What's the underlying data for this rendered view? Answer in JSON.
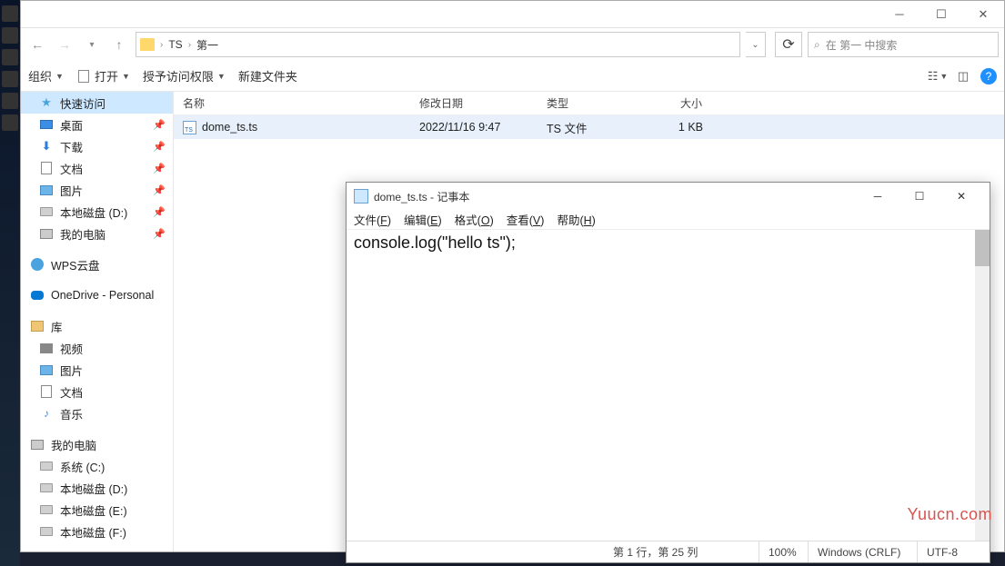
{
  "explorer": {
    "breadcrumb": {
      "seg1": "TS",
      "seg2": "第一"
    },
    "search_placeholder": "在 第一 中搜索",
    "toolbar": {
      "organize": "组织",
      "open": "打开",
      "grant": "授予访问权限",
      "new_folder": "新建文件夹"
    },
    "columns": {
      "name": "名称",
      "date": "修改日期",
      "type": "类型",
      "size": "大小"
    },
    "file": {
      "name": "dome_ts.ts",
      "date": "2022/11/16 9:47",
      "type": "TS 文件",
      "size": "1 KB"
    },
    "sidebar": {
      "quick": "快速访问",
      "desktop": "桌面",
      "downloads": "下载",
      "documents": "文档",
      "pictures": "图片",
      "disk_d": "本地磁盘 (D:)",
      "my_pc": "我的电脑",
      "wps": "WPS云盘",
      "onedrive": "OneDrive - Personal",
      "library": "库",
      "videos": "视频",
      "lib_pictures": "图片",
      "lib_documents": "文档",
      "music": "音乐",
      "this_pc": "我的电脑",
      "sys_c": "系统 (C:)",
      "ldisk_d": "本地磁盘 (D:)",
      "ldisk_e": "本地磁盘 (E:)",
      "ldisk_f": "本地磁盘 (F:)"
    }
  },
  "notepad": {
    "title": "dome_ts.ts - 记事本",
    "menu": {
      "file": "文件(F)",
      "edit": "编辑(E)",
      "format": "格式(O)",
      "view": "查看(V)",
      "help": "帮助(H)"
    },
    "content": "console.log(\"hello ts\");",
    "status": {
      "pos": "第 1 行，第 25 列",
      "zoom": "100%",
      "eol": "Windows (CRLF)",
      "enc": "UTF-8"
    }
  },
  "watermark": "Yuucn.com"
}
